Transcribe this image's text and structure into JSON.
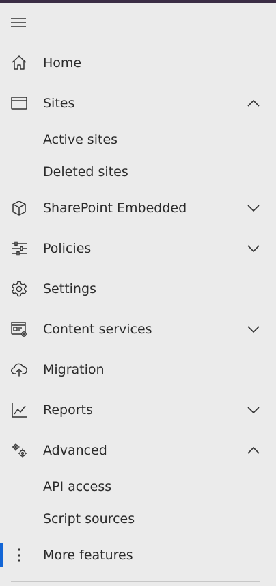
{
  "nav": {
    "home": "Home",
    "sites": "Sites",
    "active_sites": "Active sites",
    "deleted_sites": "Deleted sites",
    "sharepoint_embedded": "SharePoint Embedded",
    "policies": "Policies",
    "settings": "Settings",
    "content_services": "Content services",
    "migration": "Migration",
    "reports": "Reports",
    "advanced": "Advanced",
    "api_access": "API access",
    "script_sources": "Script sources",
    "more_features": "More features"
  },
  "icons": {
    "menu": "hamburger-icon",
    "home": "home-icon",
    "sites": "browser-window-icon",
    "sharepoint_embedded": "cube-icon",
    "policies": "sliders-icon",
    "settings": "gear-icon",
    "content_services": "content-gear-icon",
    "migration": "cloud-upload-icon",
    "reports": "line-chart-icon",
    "advanced": "gears-icon",
    "more_features": "more-vertical-icon"
  },
  "colors": {
    "background": "#ebebeb",
    "top_bar": "#3b2d45",
    "selection": "#1366d6",
    "text": "#2b2b2b"
  }
}
